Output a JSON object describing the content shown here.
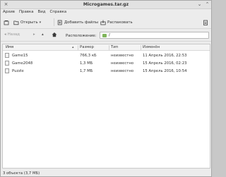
{
  "window": {
    "title": "Microgames.tar.gz"
  },
  "menubar": [
    "Архив",
    "Правка",
    "Вид",
    "Справка"
  ],
  "toolbar": {
    "open_label": "Открыть",
    "add_files_label": "Добавить файлы",
    "extract_label": "Распаковать"
  },
  "location": {
    "back_label": "Назад",
    "label": "Расположение:",
    "path": "/"
  },
  "table": {
    "columns": [
      "Имя",
      "Размер",
      "Тип",
      "Изменён"
    ],
    "rows": [
      {
        "name": "Game15",
        "size": "766,3 кБ",
        "type": "неизвестно",
        "modified": "11 Апрель 2016, 22:53"
      },
      {
        "name": "Game2048",
        "size": "1,3 МБ",
        "type": "неизвестно",
        "modified": "15 Апрель 2016, 02:23"
      },
      {
        "name": "Puzzle",
        "size": "1,7 МБ",
        "type": "неизвестно",
        "modified": "15 Апрель 2016, 10:54"
      }
    ]
  },
  "status": "3 объекта (3,7 МБ)",
  "icons": {
    "close": "close-icon",
    "restore": "restore-icon",
    "minimize": "minimize-icon",
    "folder_accent": "#7fb55a"
  }
}
